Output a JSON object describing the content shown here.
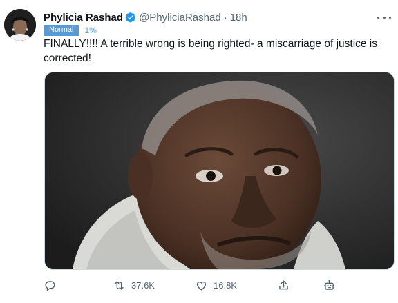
{
  "author": {
    "name": "Phylicia Rashad",
    "handle": "@PhyliciaRashad",
    "separator": "·",
    "time": "18h"
  },
  "tag": {
    "label": "Normal",
    "percent": "1%"
  },
  "tweet": {
    "text": "FINALLY!!!! A terrible wrong is being righted- a miscarriage of justice is corrected!"
  },
  "actions": {
    "reply_icon": "reply-icon",
    "retweet_count": "37.6K",
    "like_count": "16.8K",
    "share_icon": "share-icon",
    "bot_icon": "bot-icon"
  },
  "colors": {
    "verified": "#1d9bf0",
    "badge_bg": "#5b9bd5",
    "muted": "#536471"
  }
}
